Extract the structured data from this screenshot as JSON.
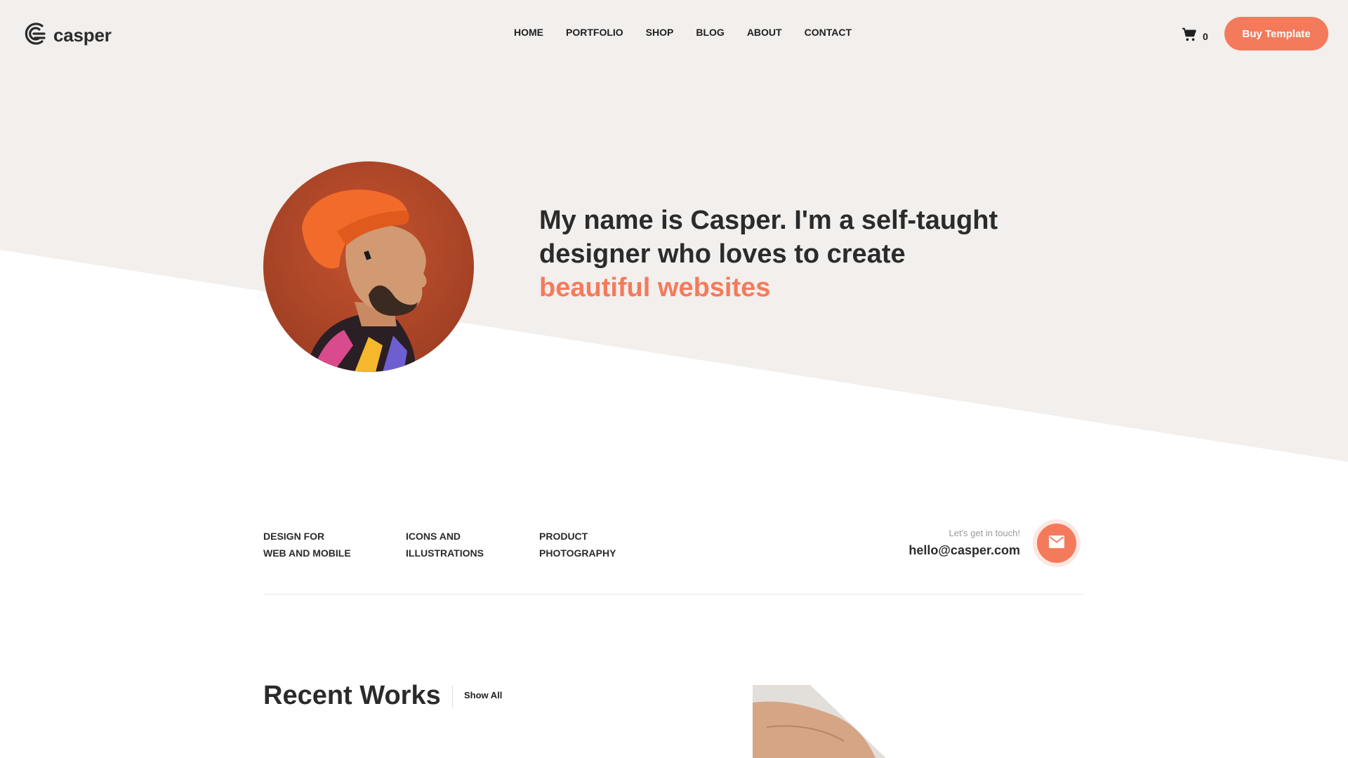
{
  "colors": {
    "accent": "#f47a5c",
    "hero_background": "#f2efec",
    "text": "#2b2b2b",
    "page_background": "#ffffff"
  },
  "header": {
    "logo_icon": "casper-c-logo-icon",
    "brand": "casper",
    "nav": [
      "HOME",
      "PORTFOLIO",
      "SHOP",
      "BLOG",
      "ABOUT",
      "CONTACT"
    ],
    "cart_icon": "shopping-cart-icon",
    "cart_count": "0",
    "cta_label": "Buy Template"
  },
  "hero": {
    "avatar_icon": "profile-photo",
    "headline_line1": "My name is Casper. I'm a self-taught",
    "headline_line2": "designer who loves to create",
    "headline_accent": "beautiful websites"
  },
  "services": [
    {
      "line1": "DESIGN FOR",
      "line2": "WEB AND MOBILE"
    },
    {
      "line1": "ICONS AND",
      "line2": "ILLUSTRATIONS"
    },
    {
      "line1": "PRODUCT",
      "line2": "PHOTOGRAPHY"
    }
  ],
  "contact": {
    "hint": "Let's get in touch!",
    "email": "hello@casper.com",
    "mail_icon": "envelope-icon"
  },
  "recent_works": {
    "title": "Recent Works",
    "show_all_label": "Show All",
    "thumb_icon": "work-thumbnail-arm-photo"
  }
}
